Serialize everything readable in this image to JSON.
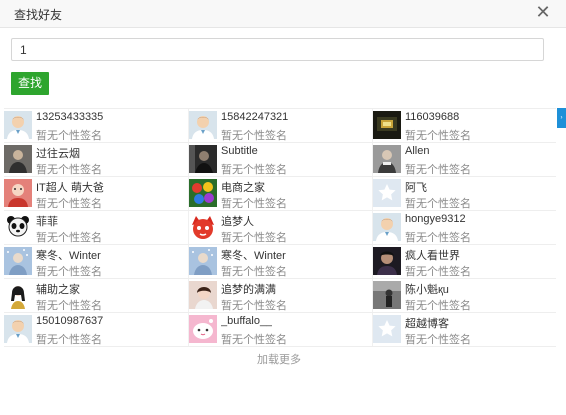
{
  "dialog": {
    "title": "查找好友",
    "close_symbol": "✕"
  },
  "search": {
    "value": "1",
    "button_label": "查找"
  },
  "results": [
    {
      "name": "13253433335",
      "signature": "暂无个性签名",
      "avatar": "default-avatar"
    },
    {
      "name": "15842247321",
      "signature": "暂无个性签名",
      "avatar": "default-avatar"
    },
    {
      "name": "116039688",
      "signature": "暂无个性签名",
      "avatar": "photo-avatar-dark-gold"
    },
    {
      "name": "过往云烟",
      "signature": "暂无个性签名",
      "avatar": "photo-avatar-person"
    },
    {
      "name": "Subtitle",
      "signature": "暂无个性签名",
      "avatar": "photo-avatar-dark"
    },
    {
      "name": "Allen",
      "signature": "暂无个性签名",
      "avatar": "photo-avatar-person-grey"
    },
    {
      "name": "IT超人 萌大爸",
      "signature": "暂无个性签名",
      "avatar": "photo-avatar-red"
    },
    {
      "name": "电商之家",
      "signature": "暂无个性签名",
      "avatar": "photo-avatar-colorful-balls"
    },
    {
      "name": "阿飞",
      "signature": "暂无个性签名",
      "avatar": "star-placeholder-avatar"
    },
    {
      "name": "菲菲",
      "signature": "暂无个性签名",
      "avatar": "panda-avatar"
    },
    {
      "name": "追梦人",
      "signature": "暂无个性签名",
      "avatar": "red-cartoon-avatar"
    },
    {
      "name": "hongye9312",
      "signature": "暂无个性签名",
      "avatar": "default-avatar"
    },
    {
      "name": "寒冬、Winter",
      "signature": "暂无个性签名",
      "avatar": "photo-avatar-snow"
    },
    {
      "name": "寒冬、Winter",
      "signature": "暂无个性签名",
      "avatar": "photo-avatar-snow"
    },
    {
      "name": "疯人看世界",
      "signature": "暂无个性签名",
      "avatar": "photo-avatar-dark-portrait"
    },
    {
      "name": "辅助之家",
      "signature": "暂无个性签名",
      "avatar": "photo-avatar-girl"
    },
    {
      "name": "追梦的满满",
      "signature": "暂无个性签名",
      "avatar": "photo-avatar-girl-2"
    },
    {
      "name": "陈小魁қu",
      "signature": "暂无个性签名",
      "avatar": "photo-avatar-grey-figure"
    },
    {
      "name": "15010987637",
      "signature": "暂无个性签名",
      "avatar": "default-avatar"
    },
    {
      "name": "_buffalo__",
      "signature": "暂无个性签名",
      "avatar": "pink-cartoon-avatar"
    },
    {
      "name": "超越博客",
      "signature": "暂无个性签名",
      "avatar": "star-placeholder-avatar"
    }
  ],
  "load_more": "加载更多",
  "colors": {
    "search_button": "#2ea52e",
    "edge_tab": "#1e90d8"
  }
}
